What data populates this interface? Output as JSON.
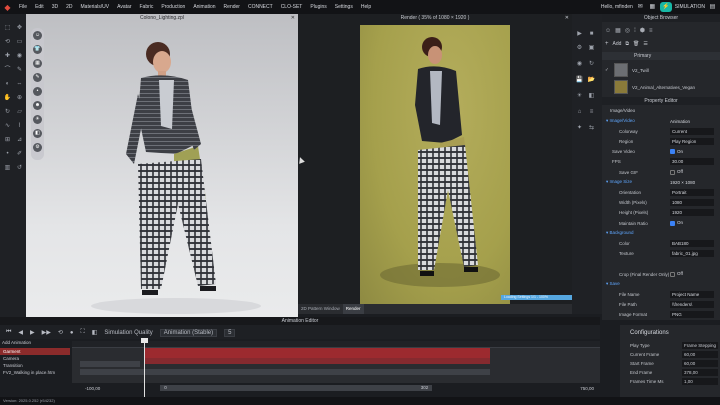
{
  "menu": [
    "File",
    "Edit",
    "3D",
    "2D",
    "Materials/UV",
    "Avatar",
    "Fabric",
    "Production",
    "Animation",
    "Render",
    "CONNECT",
    "CLO-SET",
    "Plugins",
    "Settings",
    "Help"
  ],
  "user": {
    "greeting": "Hello, mfinden",
    "simulation_label": "SIMULATION"
  },
  "viewport": {
    "title": "Colono_Lighting.zpl"
  },
  "render_view": {
    "title": "Render ( 35% of 1080 × 1920 )"
  },
  "render_tabs": [
    "2D Pattern Window",
    "Render"
  ],
  "render_progress": {
    "label": "Loading Settings 1/1 - 100%",
    "percent": 100
  },
  "object_browser": {
    "title": "Object Browser",
    "add_label": "Add",
    "primary_label": "Primary",
    "items": [
      {
        "label": "V2_Twill",
        "color": "#6c6e72"
      },
      {
        "label": "V2_Animal_Alternatives_Vegan",
        "color": "#8a7a3a"
      }
    ]
  },
  "property_editor": {
    "title": "Property Editor",
    "subtitle": "Image/Video",
    "rows": [
      {
        "label": "Image/Video",
        "value": "Animation",
        "kind": "section"
      },
      {
        "label": "Colorway",
        "value": "Current",
        "kind": "field"
      },
      {
        "label": "Region",
        "value": "Play Region",
        "kind": "field"
      },
      {
        "label": "Save Video",
        "value": "On",
        "kind": "check-on",
        "sub": true
      },
      {
        "label": "FPS",
        "value": "30.00",
        "kind": "field",
        "sub": true
      },
      {
        "label": "Save GIF",
        "value": "Off",
        "kind": "check-off"
      },
      {
        "label": "Image Size",
        "value": "1920 × 1080",
        "kind": "section"
      },
      {
        "label": "Orientation",
        "value": "Portrait",
        "kind": "field"
      },
      {
        "label": "Width (Pixels)",
        "value": "1080",
        "kind": "field"
      },
      {
        "label": "Height (Pixels)",
        "value": "1920",
        "kind": "field"
      },
      {
        "label": "Maintain Ratio",
        "value": "On",
        "kind": "check-on"
      },
      {
        "label": "Background",
        "value": "",
        "kind": "section"
      },
      {
        "label": "Color",
        "value": "BAB180",
        "kind": "field"
      },
      {
        "label": "Texture",
        "value": "fabric_01.jpg",
        "kind": "field"
      },
      {
        "label": "",
        "value": "",
        "kind": "blank"
      },
      {
        "label": "Crop (Final Render Only)",
        "value": "Off",
        "kind": "check-off"
      },
      {
        "label": "Save",
        "value": "",
        "kind": "section"
      },
      {
        "label": "File Name",
        "value": "Project Name",
        "kind": "field"
      },
      {
        "label": "File Path",
        "value": "\\\\frenders\\",
        "kind": "field"
      },
      {
        "label": "Image Format",
        "value": "PNG",
        "kind": "field"
      }
    ]
  },
  "anim_controls": {
    "quality_label": "Simulation Quality",
    "quality_value": "Animation (Stable)",
    "step_value": "5"
  },
  "anim_editor": {
    "title": "Animation Editor",
    "add_label": "Add Animation",
    "tracks": [
      "Garment",
      "Camera",
      "Transition",
      "FV2_Walking in place.htm"
    ],
    "footer_left": "-100,00",
    "footer_mid_left": "0",
    "footer_mid_right": "302",
    "footer_right": "750,00"
  },
  "configurations": {
    "title": "Configurations",
    "rows": [
      {
        "k": "Play Type",
        "v": "Frame Stepping"
      },
      {
        "k": "Current Frame",
        "v": "60,00"
      },
      {
        "k": "Start Frame",
        "v": "60,00"
      },
      {
        "k": "End Frame",
        "v": "378,00"
      },
      {
        "k": "Frames Time Ms",
        "v": "1,00"
      }
    ]
  },
  "status": {
    "version": "Version: 2025.0.252 (r54232)"
  }
}
